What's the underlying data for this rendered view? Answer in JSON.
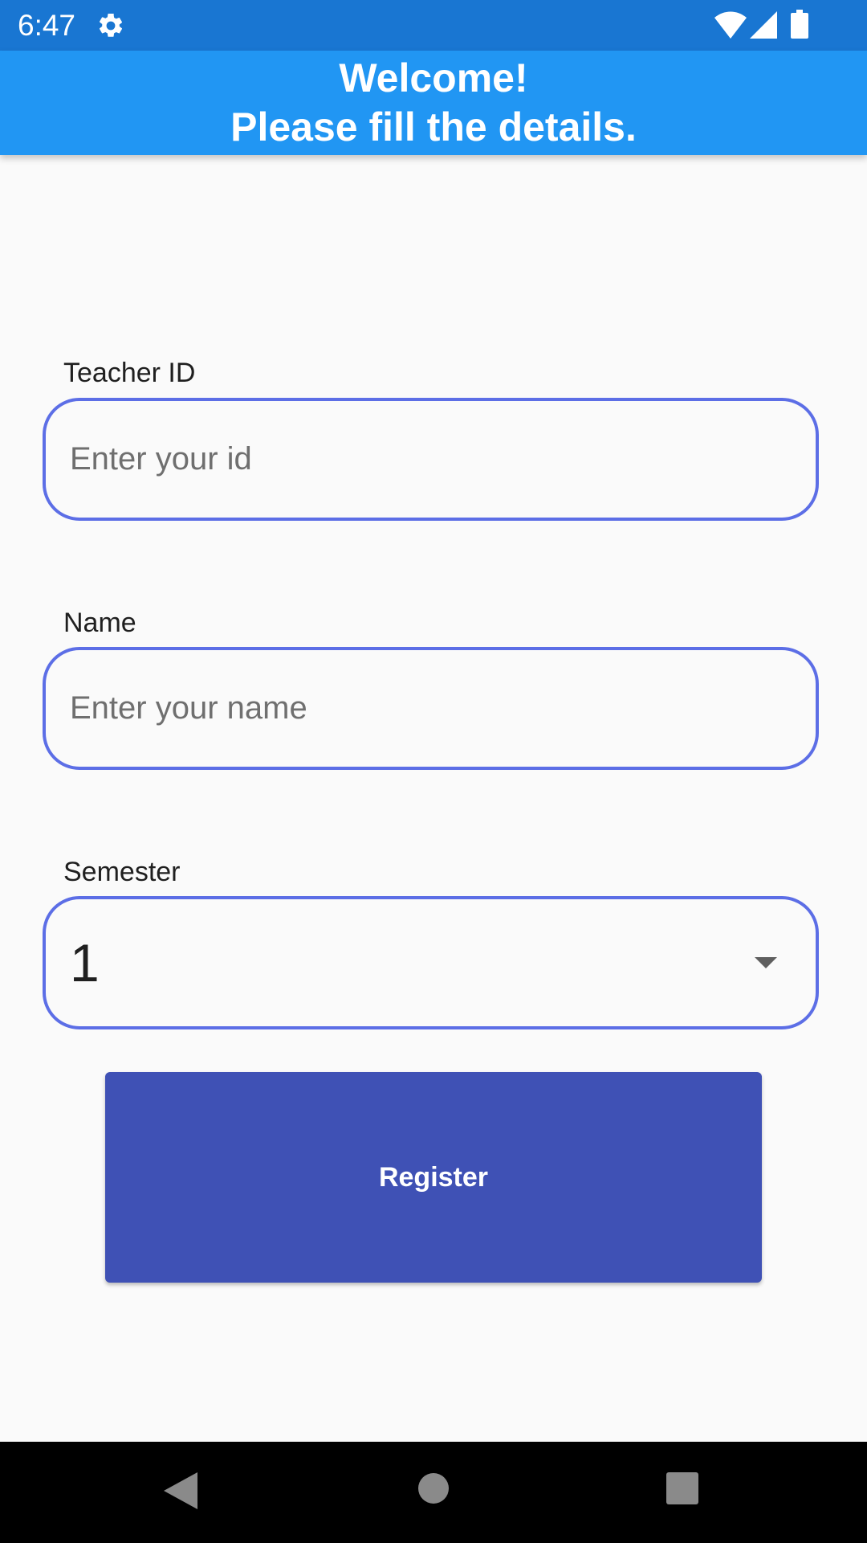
{
  "status_bar": {
    "time": "6:47",
    "icons": [
      "gear-icon",
      "wifi-icon",
      "signal-icon",
      "battery-icon"
    ],
    "background": "#1976d2"
  },
  "app_bar": {
    "title_line1": "Welcome!",
    "title_line2": "Please fill the details.",
    "background": "#2196f3"
  },
  "form": {
    "teacher_id": {
      "label": "Teacher ID",
      "placeholder": "Enter your id",
      "value": ""
    },
    "name": {
      "label": "Name",
      "placeholder": "Enter your name",
      "value": ""
    },
    "semester": {
      "label": "Semester",
      "selected": "1"
    },
    "border_color": "#5c6ee6"
  },
  "register_button": {
    "label": "Register",
    "background": "#3f51b5"
  },
  "nav_bar": {
    "icons": [
      "back-icon",
      "home-icon",
      "recents-icon"
    ]
  }
}
